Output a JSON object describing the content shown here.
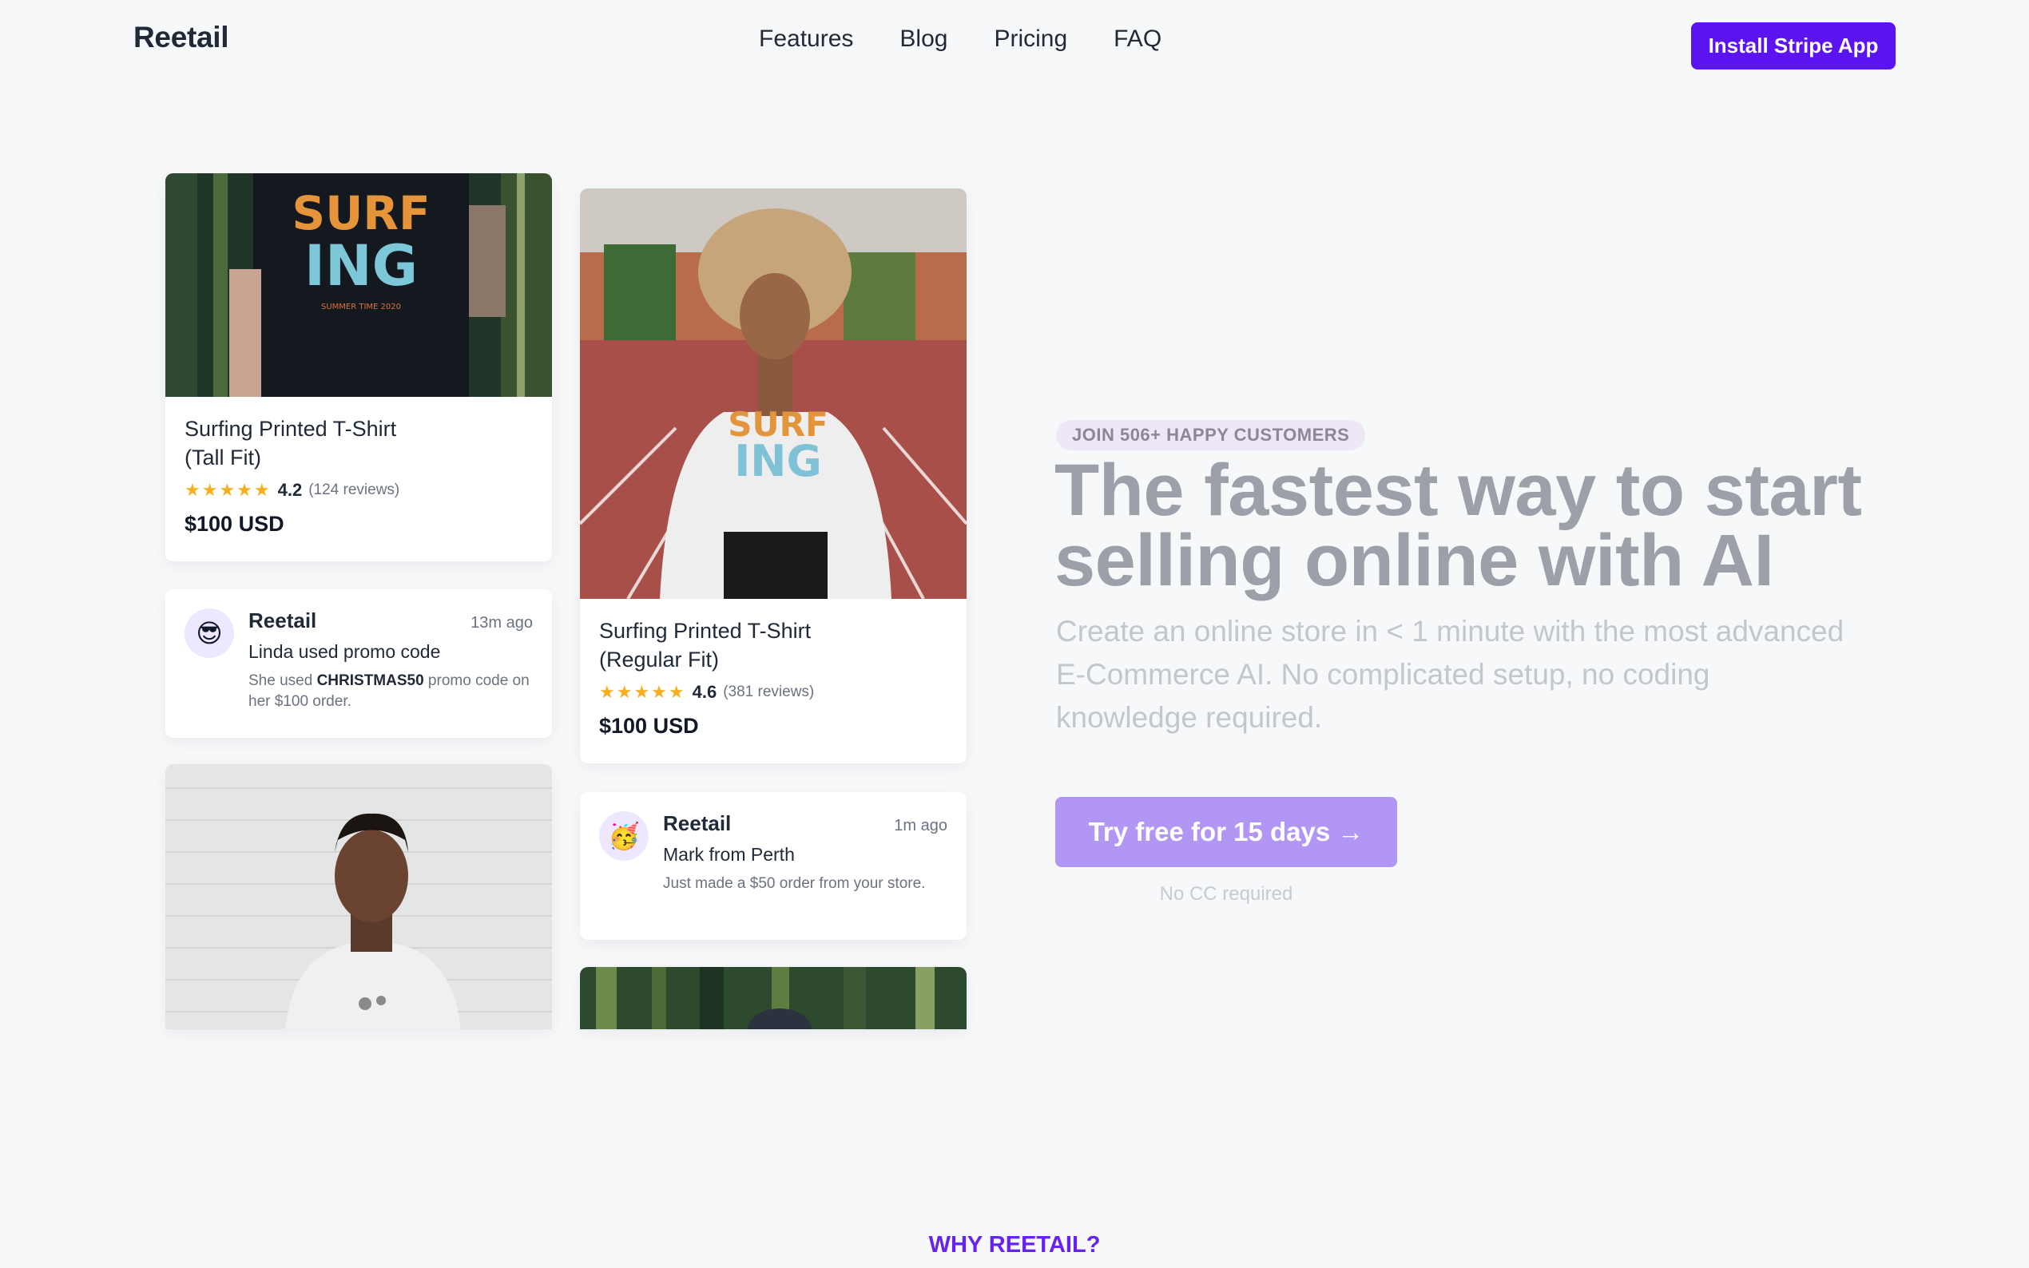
{
  "nav": {
    "logo": "Reetail",
    "links": [
      "Features",
      "Blog",
      "Pricing",
      "FAQ"
    ],
    "install_label": "Install Stripe App"
  },
  "products": [
    {
      "title_line1": "Surfing Printed T-Shirt",
      "title_line2": "(Tall Fit)",
      "rating": "4.2",
      "reviews": "(124 reviews)",
      "price": "$100 USD",
      "stars": "★★★★★",
      "rating_value": 4.2
    },
    {
      "title_line1": "Surfing Printed T-Shirt",
      "title_line2": "(Regular Fit)",
      "rating": "4.6",
      "reviews": "(381 reviews)",
      "price": "$100 USD",
      "stars": "★★★★★",
      "rating_value": 4.6
    }
  ],
  "notifications": [
    {
      "emoji": "😎",
      "brand": "Reetail",
      "time": "13m ago",
      "title": "Linda used promo code",
      "text_before": "She used ",
      "code": "CHRISTMAS50",
      "text_after": " promo code on her $100 order."
    },
    {
      "emoji": "🥳",
      "brand": "Reetail",
      "time": "1m ago",
      "title": "Mark from Perth",
      "text": "Just made a $50 order from your store."
    }
  ],
  "hero": {
    "pill": "JOIN 506+ HAPPY CUSTOMERS",
    "headline_line1": "The fastest way to start",
    "headline_line2": "selling online with AI",
    "subtext": "Create an online store in < 1 minute with the most advanced E-Commerce AI. No complicated setup, no coding knowledge required.",
    "cta": "Try free for 15 days →",
    "note": "No CC required"
  },
  "section_label": "WHY REETAIL?",
  "colors": {
    "brand": "#5b14f0",
    "cta": "#b197f3",
    "star": "#f5b01f",
    "background": "#f6f8fa"
  }
}
